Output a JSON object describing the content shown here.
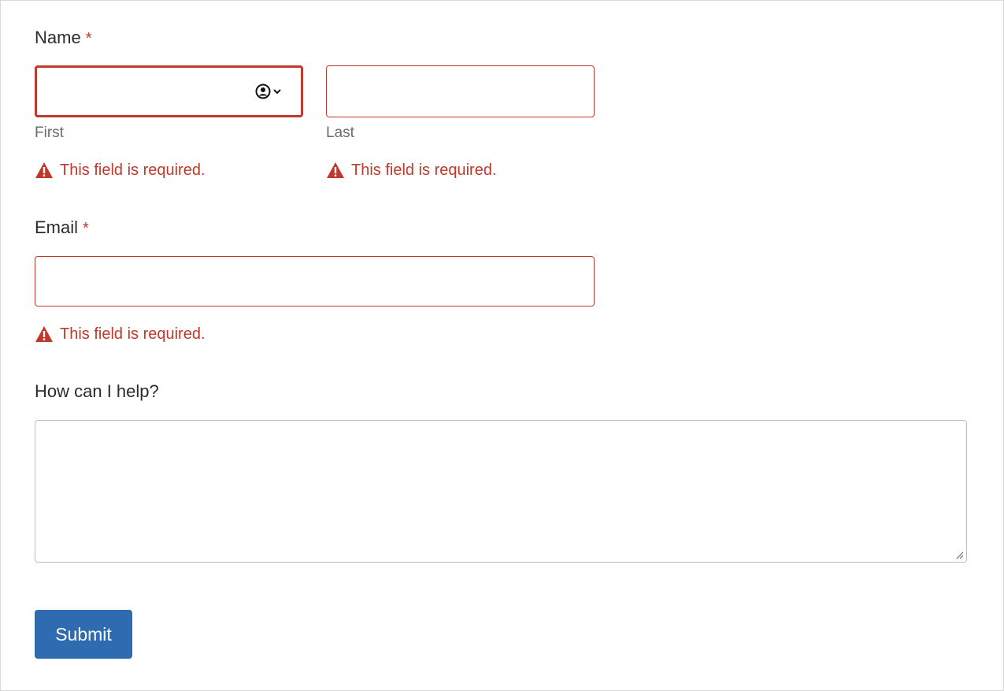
{
  "form": {
    "name": {
      "label": "Name",
      "required_mark": "*",
      "first": {
        "sublabel": "First",
        "value": "",
        "error": "This field is required."
      },
      "last": {
        "sublabel": "Last",
        "value": "",
        "error": "This field is required."
      }
    },
    "email": {
      "label": "Email",
      "required_mark": "*",
      "value": "",
      "error": "This field is required."
    },
    "help": {
      "label": "How can I help?",
      "value": ""
    },
    "submit_label": "Submit"
  },
  "icons": {
    "autofill": "person-circle-chevron-icon",
    "error": "warning-triangle-icon",
    "resize": "resize-handle-icon"
  },
  "colors": {
    "error": "#c0392b",
    "button": "#2e6bb0",
    "text": "#2b2b2b",
    "muted": "#6b6b6b",
    "border": "#bdbdbd"
  }
}
